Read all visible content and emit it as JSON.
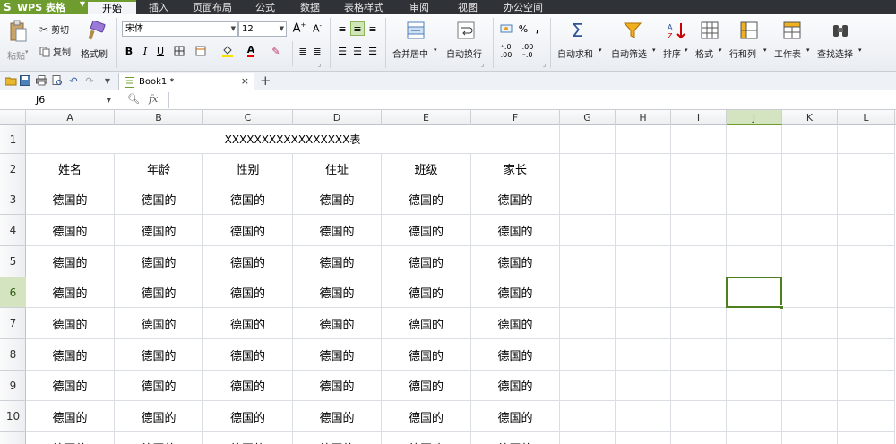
{
  "app": {
    "name": "WPS 表格",
    "logo_glyph": "S",
    "accent_color": "#6f9c2f"
  },
  "menu": {
    "tabs": [
      "开始",
      "插入",
      "页面布局",
      "公式",
      "数据",
      "表格样式",
      "审阅",
      "视图",
      "办公空间"
    ],
    "active": 0
  },
  "ribbon": {
    "paste": "粘贴",
    "cut": "剪切",
    "copy": "复制",
    "format_painter": "格式刷",
    "font_name": "宋体",
    "font_size": "12",
    "bold": "B",
    "italic": "I",
    "underline": "U",
    "merge_center": "合并居中",
    "wrap_text": "自动换行",
    "percent": "%",
    "comma": ",",
    "autosum": "自动求和",
    "autofilter": "自动筛选",
    "sort": "排序",
    "format": "格式",
    "row_col": "行和列",
    "worksheet": "工作表",
    "find_select": "查找选择"
  },
  "tabs_bar": {
    "doc_tab": "Book1 *",
    "close": "×",
    "new_tab": "+"
  },
  "formula_bar": {
    "name_box": "J6",
    "fx": "fx",
    "value": ""
  },
  "sheet": {
    "columns": [
      "A",
      "B",
      "C",
      "D",
      "E",
      "F",
      "G",
      "H",
      "I",
      "J",
      "K",
      "L"
    ],
    "selected_column": "J",
    "rows": [
      "1",
      "2",
      "3",
      "4",
      "5",
      "6",
      "7",
      "8",
      "9",
      "10"
    ],
    "selected_row": "6",
    "title": "XXXXXXXXXXXXXXXXX表",
    "headers": [
      "姓名",
      "年龄",
      "性别",
      "住址",
      "班级",
      "家长"
    ],
    "data": [
      [
        "德国的",
        "德国的",
        "德国的",
        "德国的",
        "德国的",
        "德国的"
      ],
      [
        "德国的",
        "德国的",
        "德国的",
        "德国的",
        "德国的",
        "德国的"
      ],
      [
        "德国的",
        "德国的",
        "德国的",
        "德国的",
        "德国的",
        "德国的"
      ],
      [
        "德国的",
        "德国的",
        "德国的",
        "德国的",
        "德国的",
        "德国的"
      ],
      [
        "德国的",
        "德国的",
        "德国的",
        "德国的",
        "德国的",
        "德国的"
      ],
      [
        "德国的",
        "德国的",
        "德国的",
        "德国的",
        "德国的",
        "德国的"
      ],
      [
        "德国的",
        "德国的",
        "德国的",
        "德国的",
        "德国的",
        "德国的"
      ],
      [
        "德国的",
        "德国的",
        "德国的",
        "德国的",
        "德国的",
        "德国的"
      ],
      [
        "德国的",
        "德国的",
        "德国的",
        "德国的",
        "德国的",
        "德国的"
      ]
    ]
  }
}
